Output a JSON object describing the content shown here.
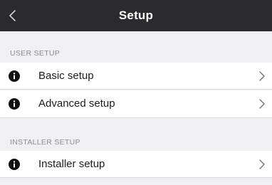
{
  "navbar": {
    "back_icon": "chevron-left-icon",
    "title": "Setup"
  },
  "sections": [
    {
      "header": "USER SETUP",
      "items": [
        {
          "label": "Basic setup",
          "icon": "info-icon",
          "chevron": ">"
        },
        {
          "label": "Advanced setup",
          "icon": "info-icon",
          "chevron": ">"
        }
      ]
    },
    {
      "header": "INSTALLER SETUP",
      "items": [
        {
          "label": "Installer setup",
          "icon": "info-icon",
          "chevron": ">"
        }
      ]
    }
  ],
  "colors": {
    "navbar_bg": "#2b2b2e",
    "page_bg": "#f0f0f2",
    "row_bg": "#ffffff",
    "section_text": "#8c8c91",
    "icon_fill": "#111111"
  }
}
